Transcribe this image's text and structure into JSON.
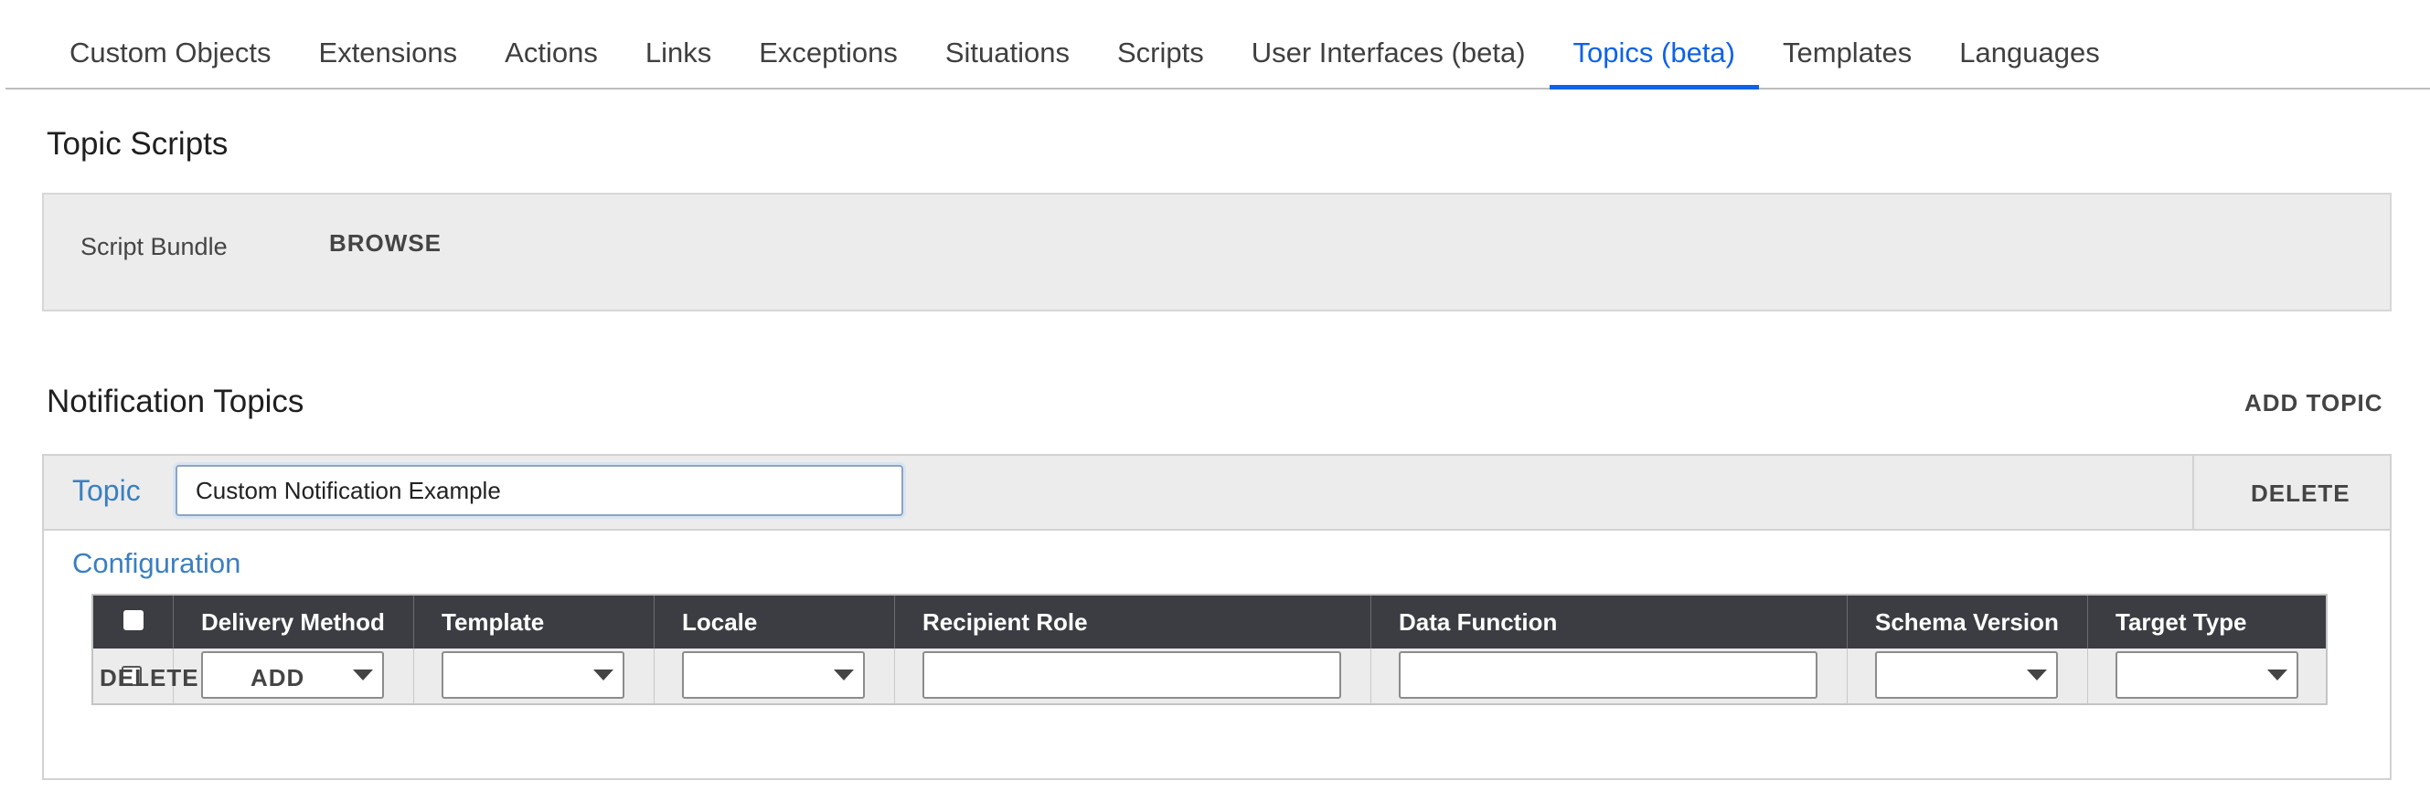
{
  "tabs": [
    {
      "label": "Custom Objects"
    },
    {
      "label": "Extensions"
    },
    {
      "label": "Actions"
    },
    {
      "label": "Links"
    },
    {
      "label": "Exceptions"
    },
    {
      "label": "Situations"
    },
    {
      "label": "Scripts"
    },
    {
      "label": "User Interfaces (beta)"
    },
    {
      "label": "Topics (beta)",
      "active": true
    },
    {
      "label": "Templates"
    },
    {
      "label": "Languages"
    }
  ],
  "topic_scripts": {
    "title": "Topic Scripts",
    "bundle_label": "Script Bundle",
    "browse_label": "BROWSE"
  },
  "notification_topics": {
    "title": "Notification Topics",
    "add_topic_label": "ADD TOPIC",
    "topic_label": "Topic",
    "topic_value": "Custom Notification Example",
    "delete_label": "DELETE",
    "configuration_label": "Configuration",
    "columns": [
      {
        "label": "Delivery Method",
        "kind": "select"
      },
      {
        "label": "Template",
        "kind": "select"
      },
      {
        "label": "Locale",
        "kind": "select"
      },
      {
        "label": "Recipient Role",
        "kind": "text"
      },
      {
        "label": "Data Function",
        "kind": "text"
      },
      {
        "label": "Schema Version",
        "kind": "select"
      },
      {
        "label": "Target Type",
        "kind": "select"
      }
    ],
    "row_delete_label": "DELETE",
    "row_add_label": "ADD"
  },
  "colors": {
    "accent": "#0f62e6",
    "link_label": "#3b7fbf",
    "grid_header": "#3b3d42",
    "panel_bg": "#ececec"
  }
}
